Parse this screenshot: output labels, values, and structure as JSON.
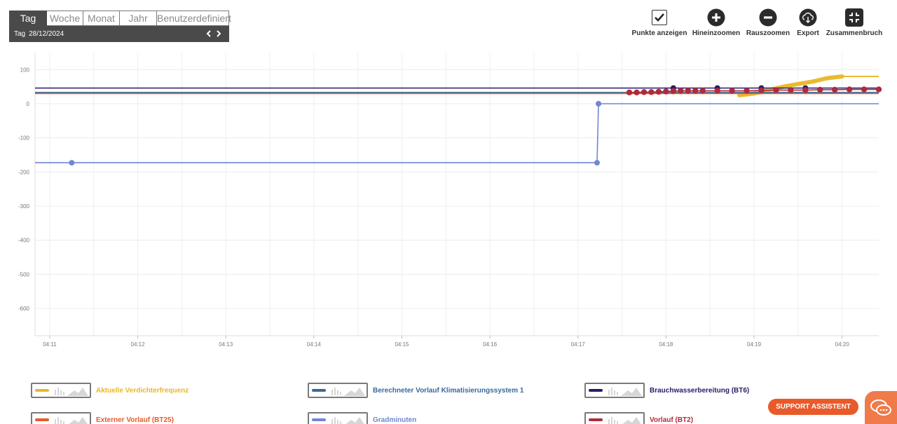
{
  "period_selector": {
    "tabs": [
      {
        "label": "Tag",
        "active": true
      },
      {
        "label": "Woche",
        "active": false
      },
      {
        "label": "Monat",
        "active": false
      },
      {
        "label": "Jahr",
        "active": false
      },
      {
        "label": "Benutzerdefiniert",
        "active": false
      }
    ],
    "date_prefix": "Tag",
    "date_value": "28/12/2024"
  },
  "toolbar": {
    "show_points_label": "Punkte anzeigen",
    "show_points_checked": true,
    "zoom_in_label": "Hineinzoomen",
    "zoom_out_label": "Rauszoomen",
    "export_label": "Export",
    "collapse_label": "Zusammenbruch"
  },
  "chart_data": {
    "type": "line",
    "xlabel": "",
    "ylabel": "",
    "ylim": [
      -680,
      150
    ],
    "xlim": [
      "04:10:50",
      "04:20:25"
    ],
    "y_ticks": [
      100,
      0,
      -100,
      -200,
      -300,
      -400,
      -500,
      -600
    ],
    "x_ticks": [
      "04:11",
      "04:12",
      "04:13",
      "04:14",
      "04:15",
      "04:16",
      "04:17",
      "04:18",
      "04:19",
      "04:20"
    ],
    "grid": true,
    "series": [
      {
        "name": "Aktuelle Verdichterfrequenz",
        "color": "#e8b82a",
        "points": [
          [
            "04:18:50",
            25
          ],
          [
            "04:19:00",
            30
          ],
          [
            "04:19:10",
            40
          ],
          [
            "04:19:20",
            50
          ],
          [
            "04:19:30",
            58
          ],
          [
            "04:19:40",
            65
          ],
          [
            "04:19:50",
            75
          ],
          [
            "04:20:00",
            80
          ],
          [
            "04:20:25",
            80
          ]
        ]
      },
      {
        "name": "Externer Vorlauf (BT25)",
        "color": "#e85a2a",
        "points": [
          [
            "04:10:50",
            30
          ],
          [
            "04:20:25",
            30
          ]
        ]
      },
      {
        "name": "Berechneter Vorlauf Klimatisierungssystem 1",
        "color": "#3a6a9a",
        "points": [
          [
            "04:10:50",
            33
          ],
          [
            "04:20:25",
            33
          ]
        ]
      },
      {
        "name": "Gradminuten",
        "color": "#6f87d4",
        "points": [
          [
            "04:10:50",
            -173
          ],
          [
            "04:11:15",
            -173
          ],
          [
            "04:17:13",
            -173
          ],
          [
            "04:17:14",
            0
          ],
          [
            "04:20:25",
            0
          ]
        ]
      },
      {
        "name": "Brauchwasserbereitung (BT6)",
        "color": "#2a1a6a",
        "points": [
          [
            "04:10:50",
            46
          ],
          [
            "04:18:05",
            46
          ],
          [
            "04:18:35",
            46
          ],
          [
            "04:19:05",
            46
          ],
          [
            "04:19:35",
            46
          ],
          [
            "04:20:25",
            46
          ]
        ]
      },
      {
        "name": "Vorlauf (BT2)",
        "color": "#b02a3a",
        "points": [
          [
            "04:17:35",
            33
          ],
          [
            "04:17:40",
            33
          ],
          [
            "04:17:45",
            34
          ],
          [
            "04:17:50",
            34
          ],
          [
            "04:17:55",
            35
          ],
          [
            "04:18:00",
            36
          ],
          [
            "04:18:05",
            37
          ],
          [
            "04:18:10",
            38
          ],
          [
            "04:18:15",
            38
          ],
          [
            "04:18:20",
            38
          ],
          [
            "04:18:25",
            38
          ],
          [
            "04:18:35",
            38
          ],
          [
            "04:18:45",
            38
          ],
          [
            "04:18:55",
            38
          ],
          [
            "04:19:05",
            39
          ],
          [
            "04:19:15",
            40
          ],
          [
            "04:19:25",
            40
          ],
          [
            "04:19:35",
            40
          ],
          [
            "04:19:45",
            41
          ],
          [
            "04:19:55",
            41
          ],
          [
            "04:20:05",
            42
          ],
          [
            "04:20:15",
            42
          ],
          [
            "04:20:25",
            42
          ]
        ]
      }
    ]
  },
  "legend": [
    {
      "label": "Aktuelle Verdichterfrequenz",
      "color": "#e8b82a"
    },
    {
      "label": "Berechneter Vorlauf Klimatisierungssystem 1",
      "color": "#3a6a9a"
    },
    {
      "label": "Brauchwasserbereitung (BT6)",
      "color": "#2a1a6a"
    },
    {
      "label": "Externer Vorlauf (BT25)",
      "color": "#e85a2a"
    },
    {
      "label": "Gradminuten",
      "color": "#6f87d4"
    },
    {
      "label": "Vorlauf (BT2)",
      "color": "#b02a3a"
    }
  ],
  "support_label": "SUPPORT ASSISTENT",
  "icons": {
    "checkbox": "check-icon",
    "zoom_in": "plus-circle-icon",
    "zoom_out": "minus-circle-icon",
    "export": "cloud-download-icon",
    "collapse": "compress-icon",
    "chat": "chat-bubbles-icon"
  }
}
